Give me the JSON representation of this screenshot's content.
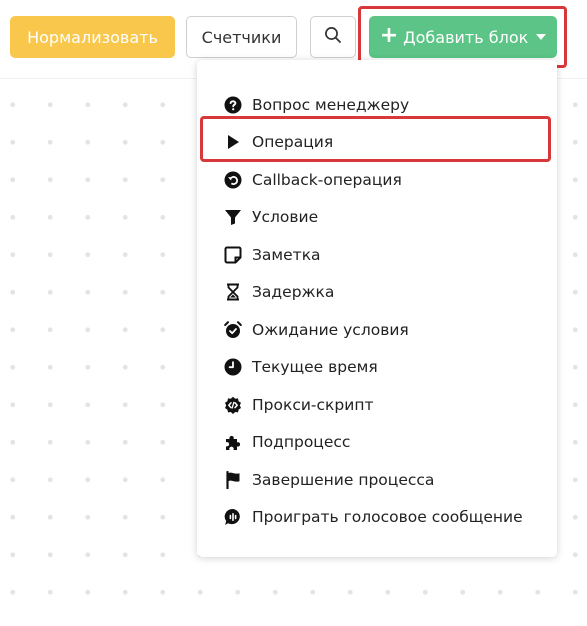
{
  "toolbar": {
    "normalize_label": "Нормализовать",
    "counters_label": "Счетчики",
    "search_icon": "search-icon",
    "add_block_label": "Добавить блок",
    "add_block_plus": "+"
  },
  "colors": {
    "normalize_bg": "#f9c74c",
    "add_block_bg": "#5cc486",
    "highlight": "#d9383a"
  },
  "menu": {
    "items": [
      {
        "label": "Вопрос менеджеру",
        "icon": "question-circle-icon"
      },
      {
        "label": "Операция",
        "icon": "play-icon"
      },
      {
        "label": "Callback-операция",
        "icon": "undo-circle-icon"
      },
      {
        "label": "Условие",
        "icon": "funnel-icon"
      },
      {
        "label": "Заметка",
        "icon": "note-icon"
      },
      {
        "label": "Задержка",
        "icon": "hourglass-icon"
      },
      {
        "label": "Ожидание условия",
        "icon": "alarm-clock-icon"
      },
      {
        "label": "Текущее время",
        "icon": "clock-icon"
      },
      {
        "label": "Прокси-скрипт",
        "icon": "code-badge-icon"
      },
      {
        "label": "Подпроцесс",
        "icon": "puzzle-icon"
      },
      {
        "label": "Завершение процесса",
        "icon": "flag-icon"
      },
      {
        "label": "Проиграть голосовое сообщение",
        "icon": "voice-message-icon"
      }
    ]
  }
}
